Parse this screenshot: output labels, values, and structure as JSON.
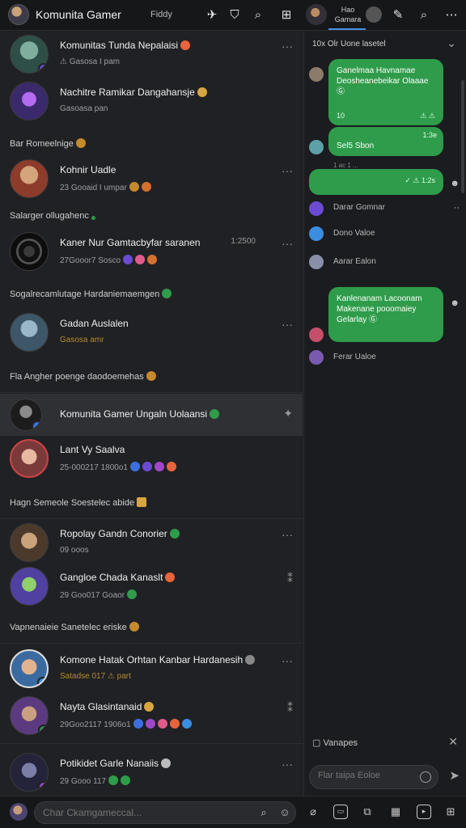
{
  "topbar": {
    "title": "Komunita Gamer",
    "subtitle": "Fiddy",
    "right_tab_label": "Hao Gamara"
  },
  "left": {
    "rows": [
      {
        "title": "Komunitas Tunda Nepalaisi",
        "sub": "⚠ Gasosa  I  pam",
        "dots": "···"
      },
      {
        "title": "Nachitre Ramikar Dangahansje",
        "sub": "Gasoasa  pan",
        "dots": "···"
      },
      {
        "title": "Kohnir Uadle",
        "sub": "23 Gooaid  I  umpar",
        "dots": "···"
      },
      {
        "title": "Kaner Nur Gamtacbyfar saranen",
        "sub": "27Gooor7  Sosco",
        "time": "1:2500",
        "dots": "···"
      },
      {
        "title": "Gadan Auslalen",
        "sub": "Gasosa  amr",
        "dots": "···"
      },
      {
        "title": "Komunita Gamer Ungaln Uolaansi",
        "sub": "",
        "dots": "✦"
      },
      {
        "title": "Lant Vy Saalva",
        "sub": "25-000217  1800o1",
        "dots": ""
      },
      {
        "title": "Ropolay Gandn Conorier",
        "sub": "09 ooos",
        "dots": "···"
      },
      {
        "title": "Gangloe Chada Kanaslt",
        "sub": "29 Goo017  Goaor",
        "dots": "⁑"
      },
      {
        "title": "Komone Hatak Orhtan Kanbar Hardanesih",
        "sub": "Satadse 017  ⚠ part",
        "dots": "···"
      },
      {
        "title": "Nayta Glasintanaid",
        "sub": "29Goo2117  1906o1",
        "dots": "⁑"
      },
      {
        "title": "Potikidet Garle Nanaiis",
        "sub": "29 Gooo 117",
        "dots": "···"
      }
    ],
    "sections": [
      "Bar Romeelnige",
      "Salarger ollugahenc",
      "Sogalrecamlutage Hardaniemaemgen",
      "Fla Angher poenge daodoemehas",
      "Hagn Semeole  Soestelec abide",
      "Vapnenaieie Sanetelec eriske"
    ]
  },
  "right": {
    "header": "10x Olr Uone lasetel",
    "bubble1_text": "Ganelmaa Havnamae Deosheanebeikar Olaaae Ⓖ",
    "bubble1_meta": "10",
    "bubble1_meta2": "⚠ ⚠",
    "bubble1_time": "1:3e",
    "bubble2_text": "Sel5 Sbon",
    "bubble2_time": "1 ac 1 ...",
    "bubble3_text": "✓ ⚠ 1:2s",
    "names": [
      "Darar Gomnar",
      "Dono Valoe",
      "Aarar Ealon",
      "Ferar Ualoe"
    ],
    "bubble4_text": "Kanlenanam Lacoonam Makenane pooomaiey Gelarlay Ⓖ",
    "bottom_label": "Vanapes",
    "input_placeholder": "Flar taipa Eoloe"
  },
  "bottombar": {
    "placeholder": "Char Ckamgameccal..."
  },
  "colors": {
    "accent_green": "#2e9c4a",
    "accent_blue": "#4a90e2",
    "gold": "#b68b2c"
  }
}
